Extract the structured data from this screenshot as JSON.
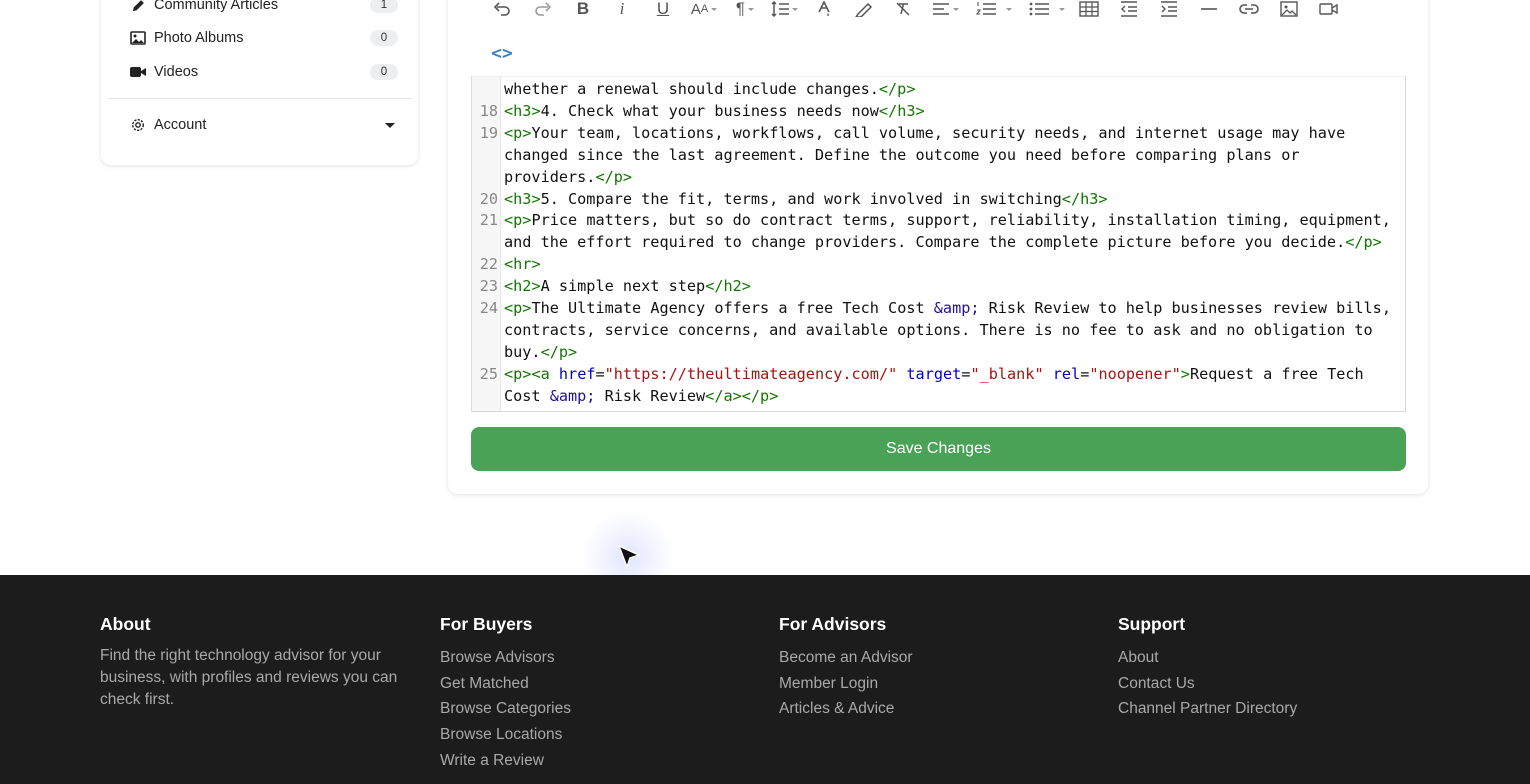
{
  "sidebar": {
    "items": [
      {
        "label": "Community Articles",
        "count": "1",
        "icon": "pencil-icon"
      },
      {
        "label": "Photo Albums",
        "count": "0",
        "icon": "image-icon"
      },
      {
        "label": "Videos",
        "count": "0",
        "icon": "video-camera-icon"
      }
    ],
    "account_label": "Account"
  },
  "editor": {
    "code_view_icon": "code-icon",
    "lines": [
      {
        "num": "",
        "text": "whether a renewal should include changes.</p>"
      },
      {
        "num": "18",
        "text": "<h3>4. Check what your business needs now</h3>"
      },
      {
        "num": "19",
        "text": "<p>Your team, locations, workflows, call volume, security needs, and internet usage may have"
      },
      {
        "num": "",
        "text": "changed since the last agreement. Define the outcome you need before comparing plans or"
      },
      {
        "num": "",
        "text": "providers.</p>"
      },
      {
        "num": "20",
        "text": "<h3>5. Compare the fit, terms, and work involved in switching</h3>"
      },
      {
        "num": "21",
        "text": "<p>Price matters, but so do contract terms, support, reliability, installation timing, equipment,"
      },
      {
        "num": "",
        "text": "and the effort required to change providers. Compare the complete picture before you decide.</p>"
      },
      {
        "num": "22",
        "text": "<hr>"
      },
      {
        "num": "23",
        "text": "<h2>A simple next step</h2>"
      },
      {
        "num": "24",
        "text": "<p>The Ultimate Agency offers a free Tech Cost &amp; Risk Review to help businesses review bills,"
      },
      {
        "num": "",
        "text": "contracts, service concerns, and available options. There is no fee to ask and no obligation to"
      },
      {
        "num": "",
        "text": "buy.</p>"
      },
      {
        "num": "25",
        "text": "<p><a href=\"https://theultimateagency.com/\" target=\"_blank\" rel=\"noopener\">Request a free Tech"
      },
      {
        "num": "",
        "text": "Cost &amp; Risk Review</a></p>"
      }
    ],
    "save_label": "Save Changes"
  },
  "colors": {
    "save_button": "#4aa257",
    "footer_bg": "#1c1c1c",
    "code_tag": "#117700",
    "code_attr": "#0000cc",
    "code_string": "#aa1111"
  },
  "footer": {
    "about": {
      "heading": "About",
      "text": "Find the right technology advisor for your business, with profiles and reviews you can check first."
    },
    "buyers": {
      "heading": "For Buyers",
      "links": [
        "Browse Advisors",
        "Get Matched",
        "Browse Categories",
        "Browse Locations",
        "Write a Review"
      ]
    },
    "advisors": {
      "heading": "For Advisors",
      "links": [
        "Become an Advisor",
        "Member Login",
        "Articles & Advice"
      ]
    },
    "support": {
      "heading": "Support",
      "links": [
        "About",
        "Contact Us",
        "Channel Partner Directory"
      ]
    }
  }
}
